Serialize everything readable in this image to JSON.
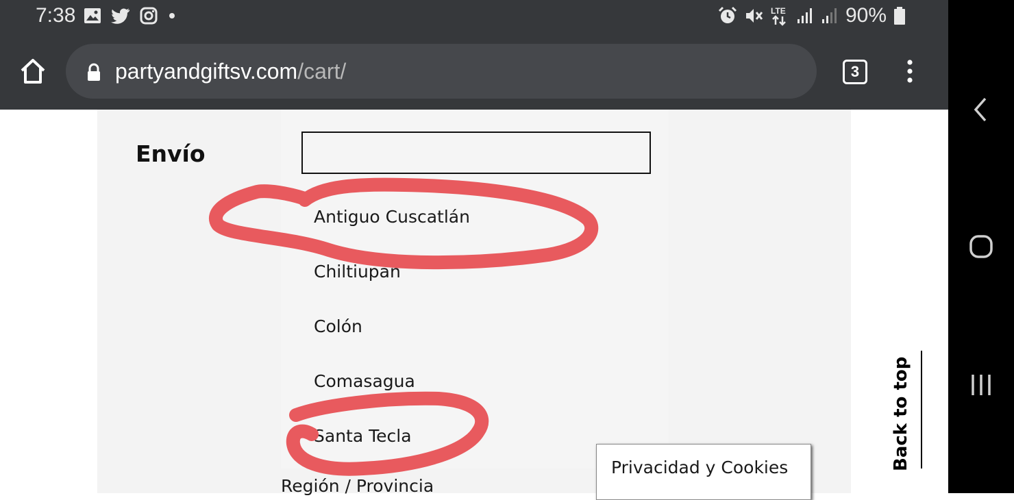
{
  "status_bar": {
    "time": "7:38",
    "left_icons": [
      "gallery-icon",
      "twitter-icon",
      "instagram-icon",
      "dot-icon"
    ],
    "right_icons": [
      "alarm-icon",
      "mute-icon",
      "lte-icon",
      "signal-icon",
      "signal-icon-2",
      "battery-icon"
    ],
    "battery": "90%"
  },
  "browser": {
    "url_domain": "partyandgiftsv.com",
    "url_path": "/cart/",
    "tab_count": "3"
  },
  "cart": {
    "shipping_label": "Envío",
    "dropdown": {
      "search_value": "",
      "options": [
        {
          "label": "Antiguo Cuscatlán",
          "highlighted": true
        },
        {
          "label": "Chiltiupán",
          "highlighted": false
        },
        {
          "label": "Colón",
          "highlighted": false
        },
        {
          "label": "Comasagua",
          "highlighted": false
        },
        {
          "label": "Santa Tecla",
          "highlighted": true
        }
      ]
    },
    "region_label": "Región / Provincia",
    "privacy_label": "Privacidad y Cookies",
    "back_to_top": "Back to top"
  },
  "colors": {
    "chrome": "#36383b",
    "annotation": "#e85a5e",
    "panel": "#f5f5f5"
  }
}
